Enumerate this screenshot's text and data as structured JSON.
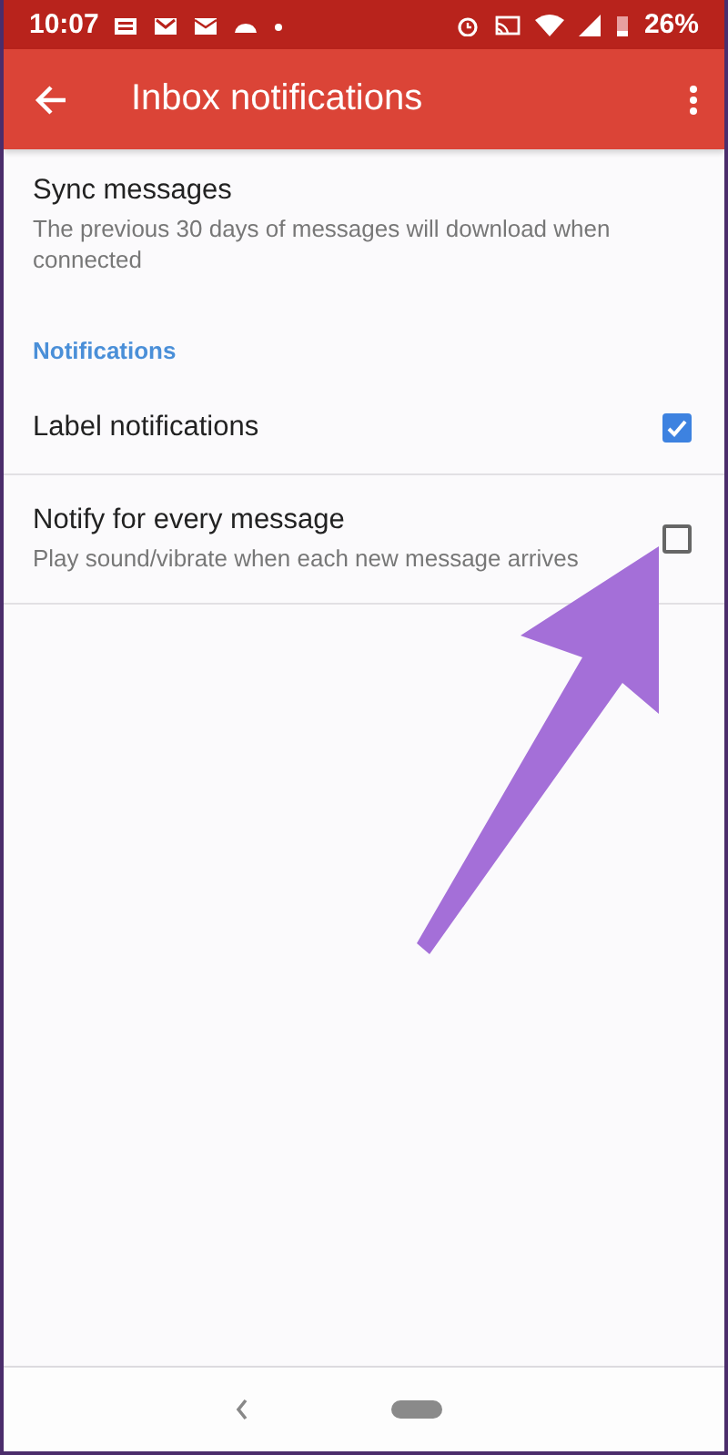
{
  "status_bar": {
    "time": "10:07",
    "battery": "26%"
  },
  "toolbar": {
    "title": "Inbox notifications"
  },
  "settings": [
    {
      "kind": "plain",
      "title": "Sync messages",
      "summary": "The previous 30 days of messages will download when connected"
    },
    {
      "kind": "category",
      "title": "Notifications"
    },
    {
      "kind": "checkbox",
      "title": "Label notifications",
      "checked": true
    },
    {
      "kind": "checkbox",
      "title": "Notify for every message",
      "summary": "Play sound/vibrate when each new message arrives",
      "checked": false
    }
  ]
}
